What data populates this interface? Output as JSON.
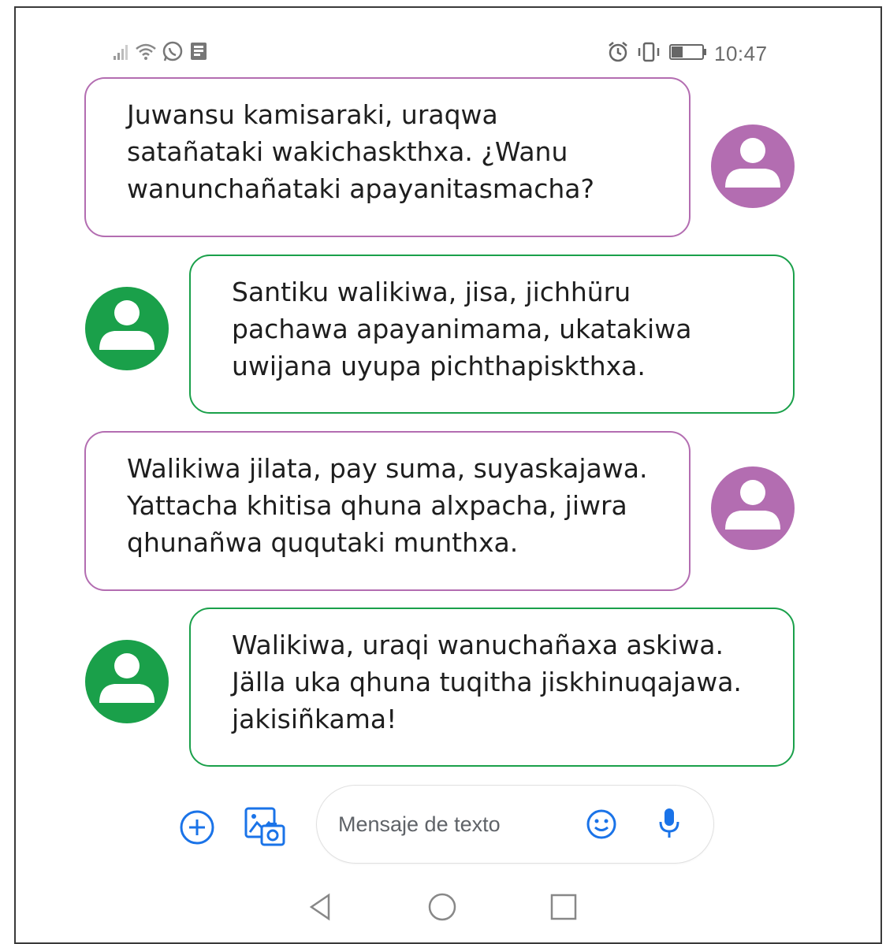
{
  "status_bar": {
    "left_icons": [
      "signal-icon",
      "wifi-icon",
      "whatsapp-icon",
      "notification-icon"
    ],
    "right_icons": [
      "alarm-icon",
      "vibrate-icon",
      "battery-icon"
    ],
    "time": "10:47"
  },
  "colors": {
    "incoming": "#b36db1",
    "outgoing": "#1aa04a",
    "accent_blue": "#1a73e8"
  },
  "messages": [
    {
      "sender": "incoming",
      "lines": [
        "Juwansu kamisaraki, uraqwa",
        "satañataki wakichaskthxa. ¿Wanu",
        "wanunchañataki apayanitasmacha?"
      ]
    },
    {
      "sender": "outgoing",
      "lines": [
        "Santiku walikiwa, jisa, jichhüru",
        "pachawa apayanimama, ukatakiwa",
        "uwijana uyupa pichthapiskthxa."
      ]
    },
    {
      "sender": "incoming",
      "lines": [
        "Walikiwa jilata, pay suma, suyaskajawa.",
        "Yattacha khitisa qhuna alxpacha, jiwra",
        "qhunañwa ququtaki munthxa."
      ]
    },
    {
      "sender": "outgoing",
      "lines": [
        "Walikiwa, uraqi wanuchañaxa askiwa.",
        "Jälla uka qhuna tuqitha jiskhinuqajawa.",
        "jakisiñkama!"
      ]
    }
  ],
  "compose": {
    "placeholder": "Mensaje de texto",
    "icons": [
      "add-icon",
      "gallery-icon",
      "emoji-icon",
      "microphone-icon"
    ]
  },
  "nav": {
    "icons": [
      "back-icon",
      "home-icon",
      "recents-icon"
    ]
  }
}
